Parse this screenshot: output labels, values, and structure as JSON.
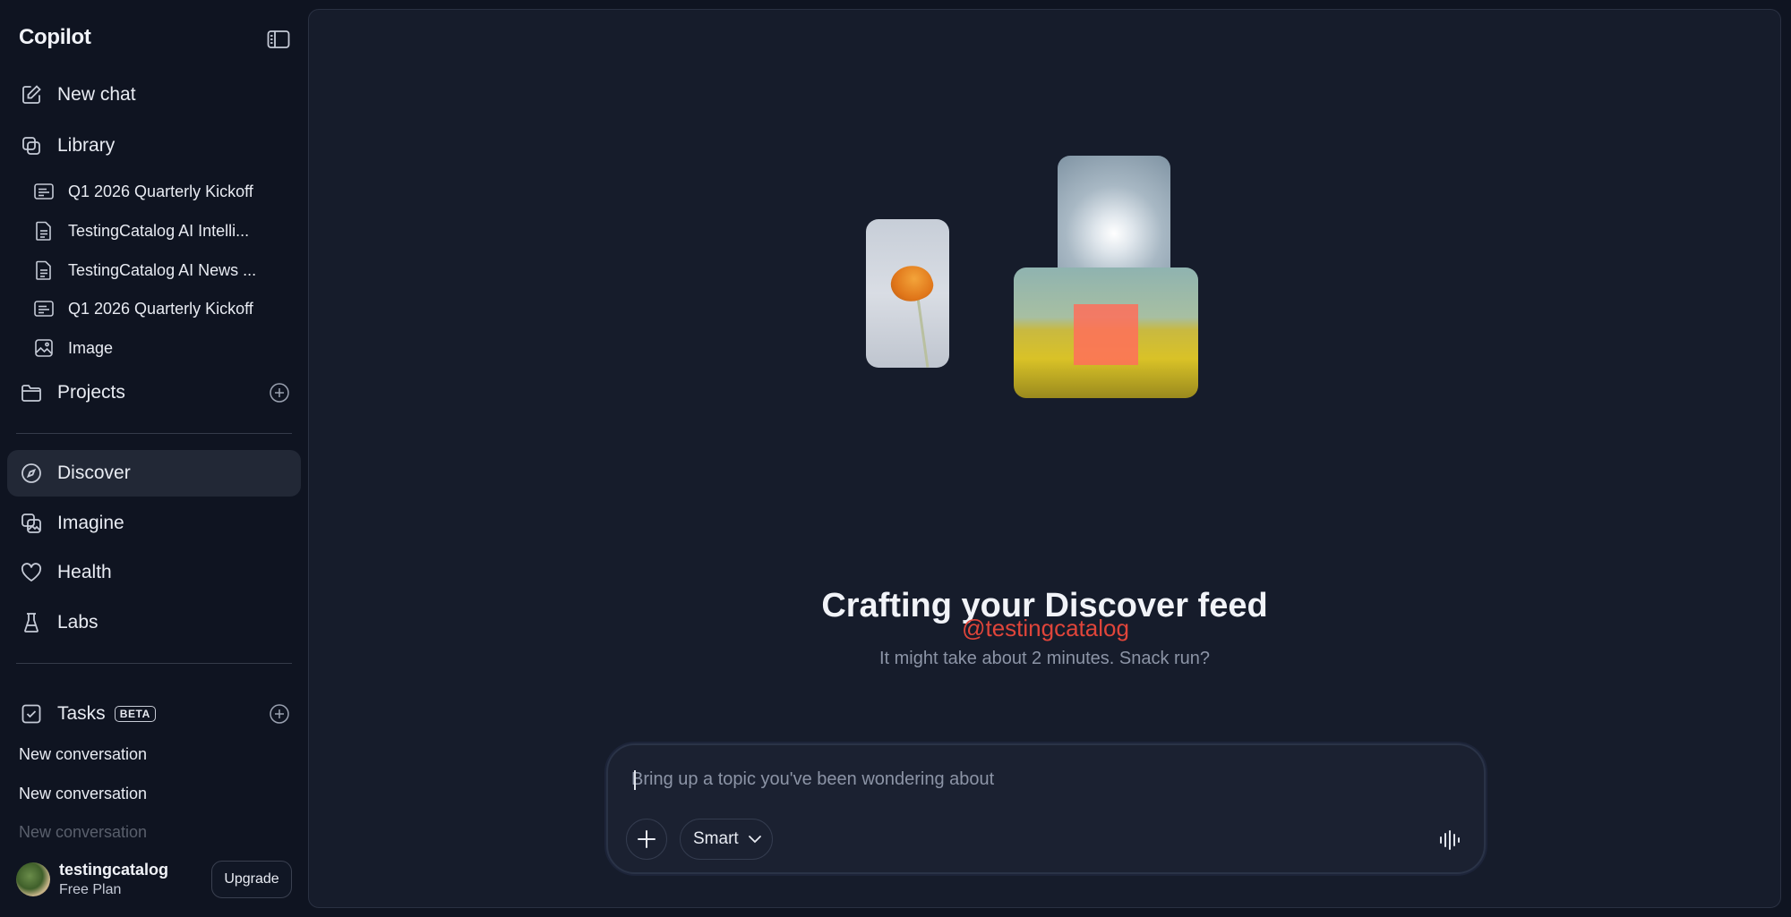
{
  "app": {
    "brand": "Copilot"
  },
  "sidebar": {
    "nav_top": [
      {
        "label": "New chat",
        "icon": "compose-icon"
      },
      {
        "label": "Library",
        "icon": "library-icon"
      }
    ],
    "library_items": [
      {
        "label": "Q1 2026 Quarterly Kickoff",
        "icon": "page-icon"
      },
      {
        "label": "TestingCatalog AI Intelli...",
        "icon": "document-icon"
      },
      {
        "label": "TestingCatalog AI News ...",
        "icon": "document-icon"
      },
      {
        "label": "Q1 2026 Quarterly Kickoff",
        "icon": "page-icon"
      },
      {
        "label": "Image",
        "icon": "image-icon"
      }
    ],
    "projects": {
      "label": "Projects",
      "icon": "folder-icon"
    },
    "nav_main": [
      {
        "label": "Discover",
        "icon": "compass-icon",
        "active": true
      },
      {
        "label": "Imagine",
        "icon": "imagine-icon"
      },
      {
        "label": "Health",
        "icon": "heart-icon"
      },
      {
        "label": "Labs",
        "icon": "flask-icon"
      }
    ],
    "tasks": {
      "label": "Tasks",
      "badge": "BETA"
    },
    "conversations": [
      "New conversation",
      "New conversation",
      "New conversation"
    ],
    "user": {
      "name": "testingcatalog",
      "plan": "Free Plan",
      "upgrade_label": "Upgrade"
    }
  },
  "main": {
    "headline": "Crafting your Discover feed",
    "watermark": "@testingcatalog",
    "subline": "It might take about 2 minutes. Snack run?"
  },
  "composer": {
    "placeholder": "Bring up a topic you've been wondering about",
    "value": "",
    "mode": "Smart"
  },
  "colors": {
    "background": "#0f1421",
    "panel": "#161c2b",
    "active_item": "#222836",
    "watermark": "#e0453a"
  }
}
